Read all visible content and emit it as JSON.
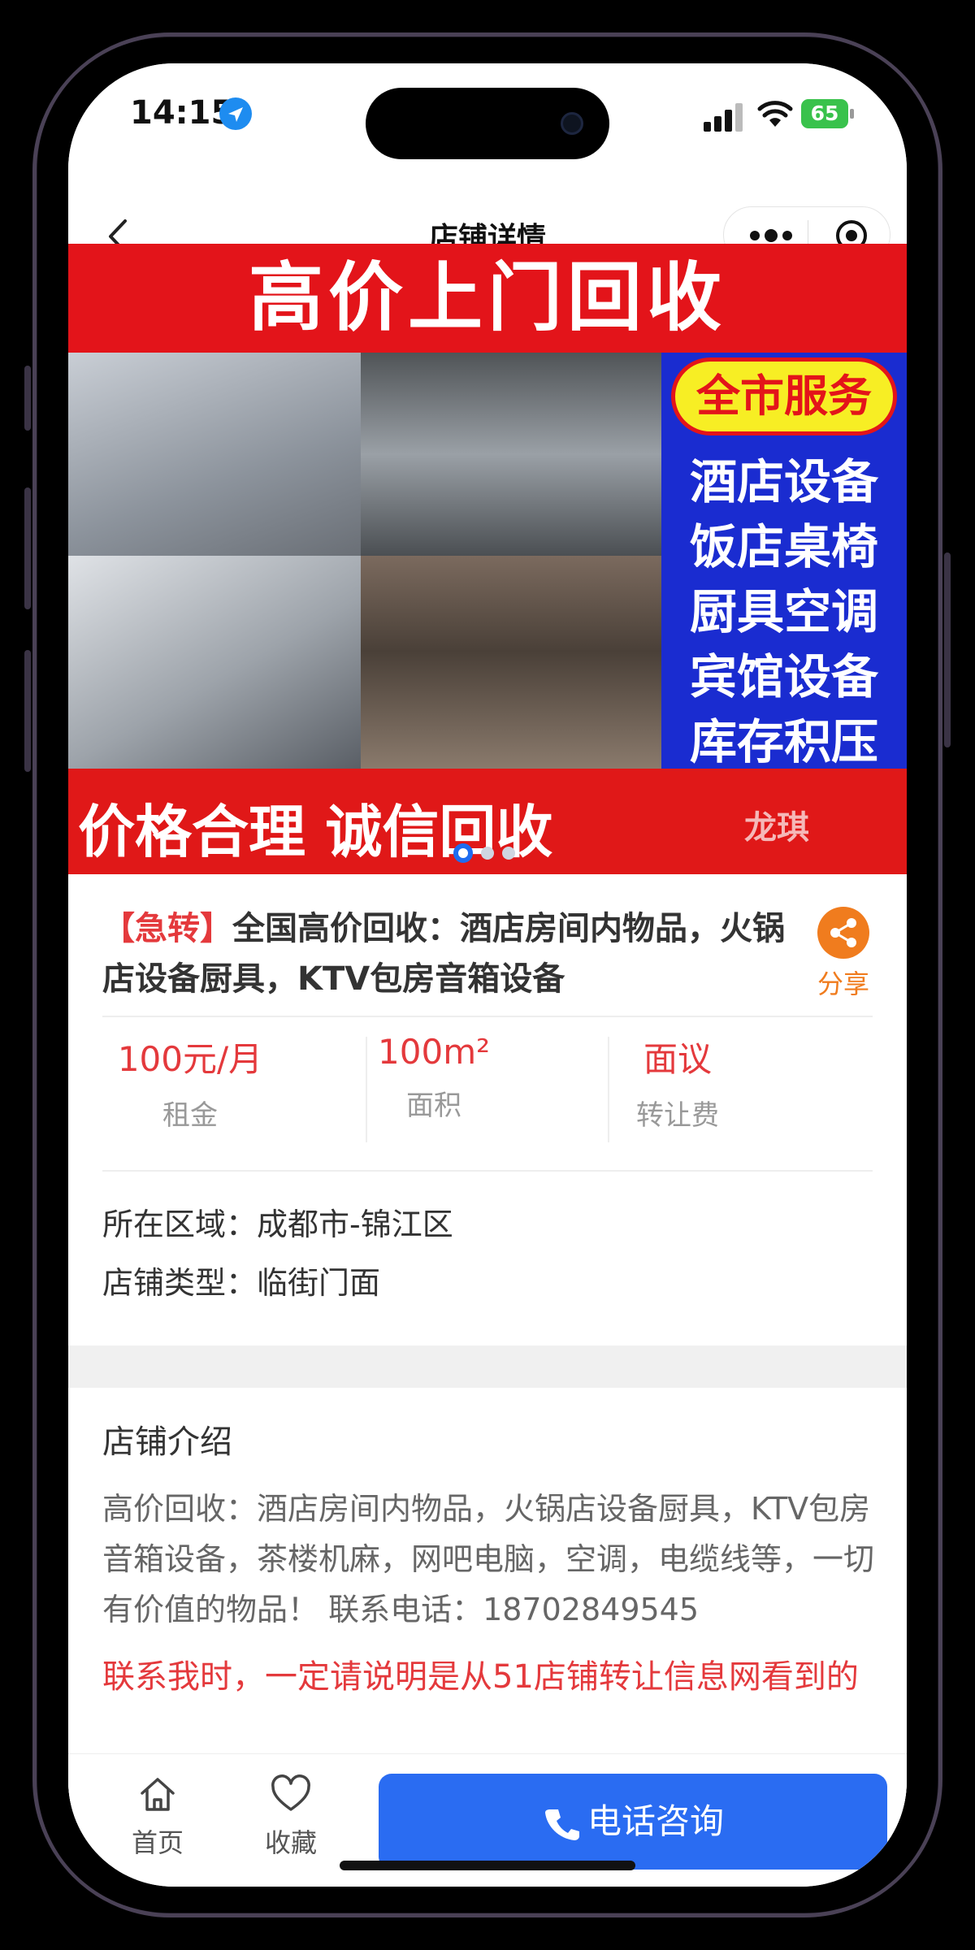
{
  "status": {
    "time": "14:15",
    "battery": "65"
  },
  "nav": {
    "title": "店铺详情"
  },
  "banner": {
    "headline": "高价上门回收",
    "service_badge": "全市服务",
    "services": [
      "酒店设备",
      "饭店桌椅",
      "厨具空调",
      "宾馆设备",
      "库存积压"
    ],
    "slogan": "价格合理 诚信回收",
    "watermark": "龙琪",
    "slide_count": 3,
    "active_slide": 1
  },
  "listing": {
    "tag": "【急转】",
    "title": "全国高价回收：酒店房间内物品，火锅店设备厨具，KTV包房音箱设备",
    "share_label": "分享",
    "rent_value": "100元/月",
    "rent_label": "租金",
    "area_value": "100m²",
    "area_label": "面积",
    "fee_value": "面议",
    "fee_label": "转让费",
    "region_label": "所在区域：",
    "region_value": "成都市-锦江区",
    "type_label": "店铺类型：",
    "type_value": "临街门面"
  },
  "intro": {
    "heading": "店铺介绍",
    "text": "高价回收：酒店房间内物品，火锅店设备厨具，KTV包房音箱设备，茶楼机麻，网吧电脑，空调，电缆线等，一切有价值的物品！ 联系电话：18702849545",
    "notice": "联系我时，一定请说明是从51店铺转让信息网看到的"
  },
  "tabbar": {
    "home": "首页",
    "favorite": "收藏",
    "call": "电话咨询"
  },
  "colors": {
    "accent": "#e4393c",
    "primary": "#2a6cf2",
    "share": "#f07c1e"
  }
}
